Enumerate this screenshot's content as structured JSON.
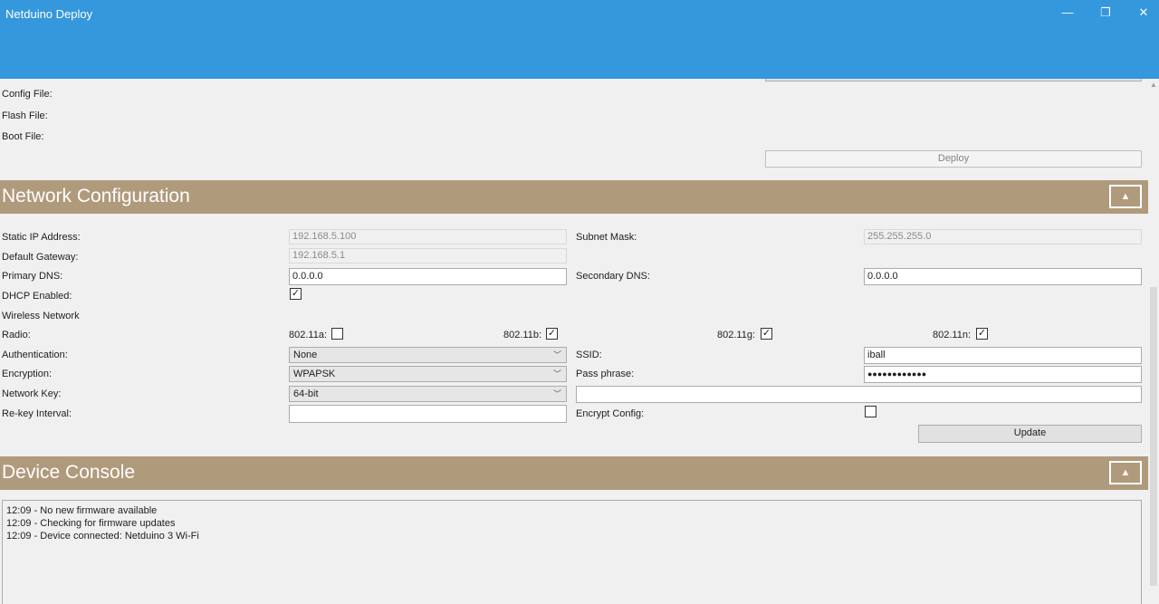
{
  "window": {
    "title": "Netduino Deploy",
    "minimize_icon": "minimize-icon",
    "maximize_icon": "restore-icon",
    "close_icon": "close-icon",
    "minimize_glyph": "—",
    "restore_glyph": "❐",
    "close_glyph": "✕",
    "accent_color": "#3597dc"
  },
  "deploy_section": {
    "config_file_label": "Config File:",
    "flash_file_label": "Flash File:",
    "boot_file_label": "Boot File:",
    "deploy_button": "Deploy"
  },
  "network": {
    "header": "Network Configuration",
    "header_color": "#b09a7c",
    "collapse_glyph": "▲",
    "static_ip_label": "Static IP Address:",
    "static_ip_value": "192.168.5.100",
    "subnet_mask_label": "Subnet Mask:",
    "subnet_mask_value": "255.255.255.0",
    "default_gateway_label": "Default Gateway:",
    "default_gateway_value": "192.168.5.1",
    "primary_dns_label": "Primary DNS:",
    "primary_dns_value": "0.0.0.0",
    "secondary_dns_label": "Secondary DNS:",
    "secondary_dns_value": "0.0.0.0",
    "dhcp_label": "DHCP Enabled:",
    "dhcp_checked": true,
    "wireless_label": "Wireless Network",
    "radio_label": "Radio:",
    "radios": [
      {
        "label": "802.11a:",
        "checked": false
      },
      {
        "label": "802.11b:",
        "checked": true
      },
      {
        "label": "802.11g:",
        "checked": true
      },
      {
        "label": "802.11n:",
        "checked": true
      }
    ],
    "authentication_label": "Authentication:",
    "authentication_value": "None",
    "ssid_label": "SSID:",
    "ssid_value": "iball",
    "encryption_label": "Encryption:",
    "encryption_value": "WPAPSK",
    "pass_phrase_label": "Pass phrase:",
    "pass_phrase_value": "●●●●●●●●●●●●",
    "network_key_label": "Network Key:",
    "network_key_value": "64-bit",
    "network_key_text": "",
    "rekey_label": "Re-key Interval:",
    "rekey_value": "",
    "encrypt_config_label": "Encrypt Config:",
    "encrypt_config_checked": false,
    "update_button": "Update"
  },
  "console": {
    "header": "Device Console",
    "collapse_glyph": "▲",
    "lines": [
      "12:09 - No new firmware available",
      "12:09 - Checking for firmware updates",
      "12:09 - Device connected: Netduino 3 Wi-Fi"
    ]
  },
  "scrollbar": {
    "up_glyph": "▲"
  }
}
